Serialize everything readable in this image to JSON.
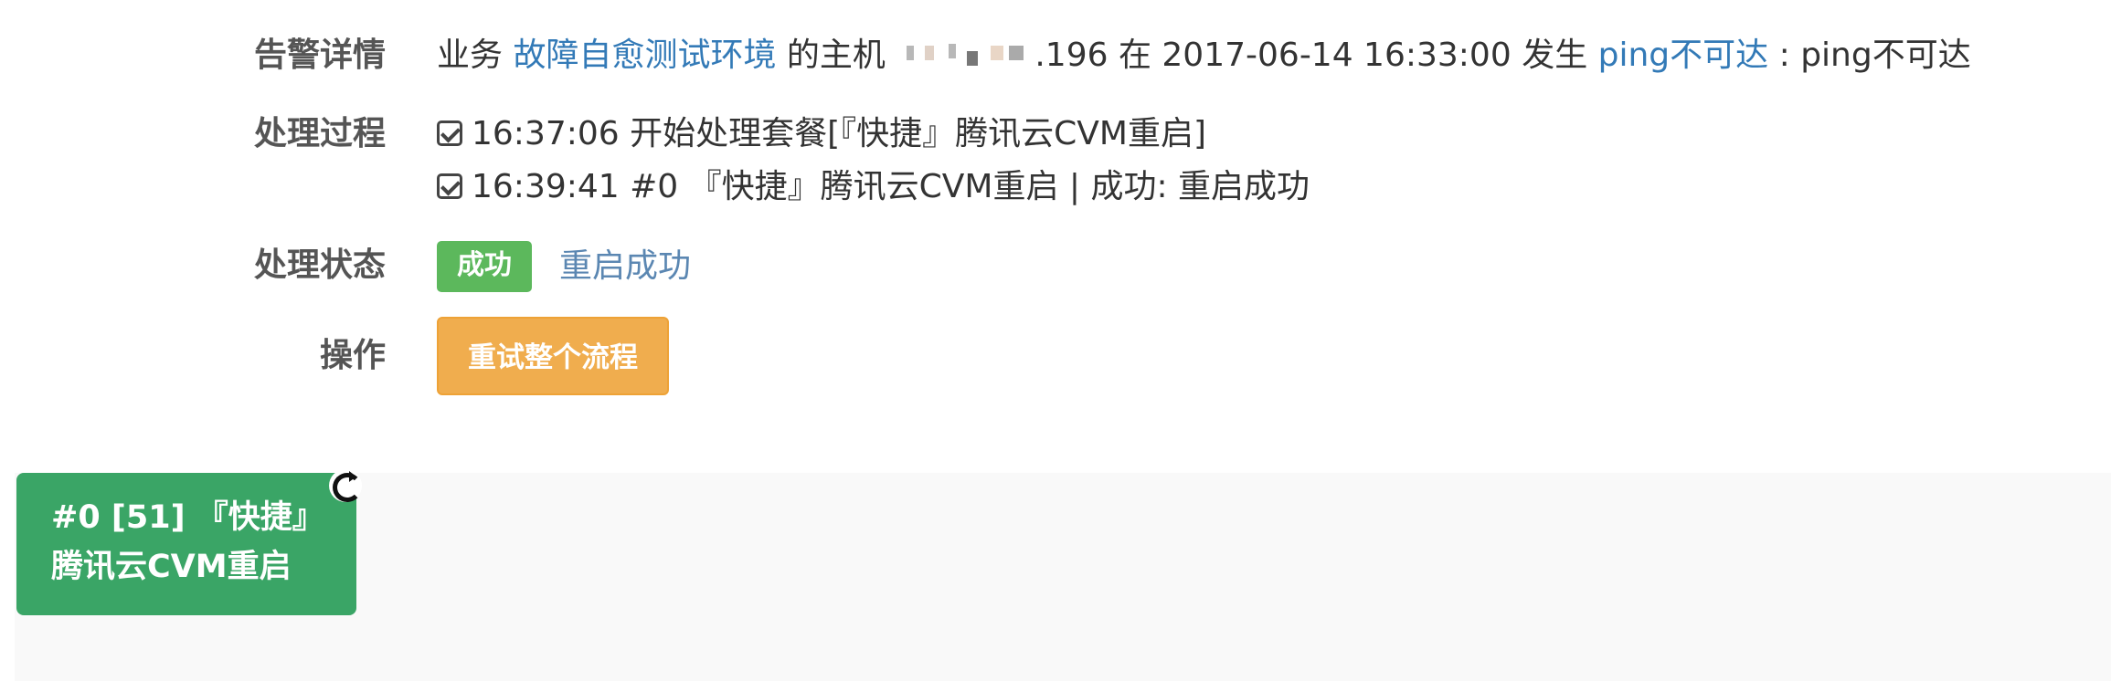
{
  "alarm": {
    "label": "告警详情",
    "prefix": "业务 ",
    "business": "故障自愈测试环境",
    "host_text": " 的主机 ",
    "ip_suffix": ".196",
    "time_text": " 在 2017-06-14 16:33:00 发生 ",
    "type_link": "ping不可达",
    "type_detail": " : ping不可达"
  },
  "process": {
    "label": "处理过程",
    "steps": [
      "16:37:06 开始处理套餐[『快捷』腾讯云CVM重启]",
      "16:39:41 #0 『快捷』腾讯云CVM重启 | 成功: 重启成功"
    ]
  },
  "status": {
    "label": "处理状态",
    "badge": "成功",
    "text": "重启成功",
    "badge_color": "#5cb85c"
  },
  "operation": {
    "label": "操作",
    "retry_label": "重试整个流程",
    "button_color": "#f0ad4e"
  },
  "flow": {
    "node_line1": "#0 [51] 『快捷』",
    "node_line2": "腾讯云CVM重启",
    "node_color": "#3aa566",
    "node_icon": "refresh-icon"
  }
}
